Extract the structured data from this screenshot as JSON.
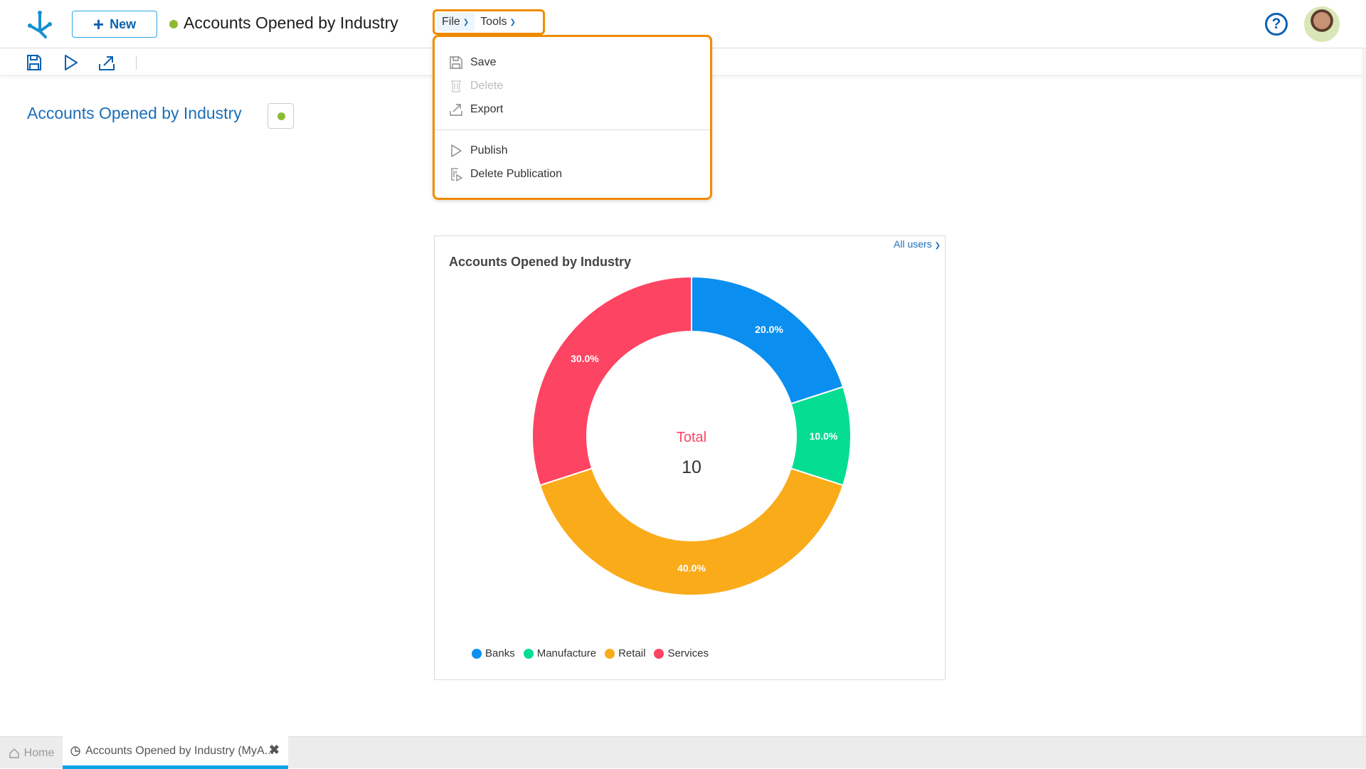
{
  "header": {
    "new_label": "New",
    "title": "Accounts Opened by Industry",
    "menus": [
      {
        "label": "File",
        "active": true
      },
      {
        "label": "Tools"
      }
    ],
    "help_icon": "question-circle-icon"
  },
  "toolbar": {
    "icons": [
      "save-icon",
      "play-icon",
      "export-icon"
    ]
  },
  "page": {
    "title": "Accounts Opened by Industry",
    "status_color": "#8dba33"
  },
  "file_menu": {
    "items": [
      {
        "label": "Save",
        "icon": "save-icon",
        "disabled": false
      },
      {
        "label": "Delete",
        "icon": "trash-icon",
        "disabled": true
      },
      {
        "label": "Export",
        "icon": "export-icon",
        "disabled": false
      },
      {
        "label": "Publish",
        "icon": "play-icon",
        "disabled": false
      },
      {
        "label": "Delete Publication",
        "icon": "delete-publication-icon",
        "disabled": false
      }
    ]
  },
  "card": {
    "filter_label": "All users"
  },
  "chart_data": {
    "type": "pie",
    "variant": "donut",
    "title": "Accounts Opened by Industry",
    "center_label": "Total",
    "center_value": "10",
    "categories": [
      "Banks",
      "Manufacture",
      "Retail",
      "Services"
    ],
    "values": [
      2,
      1,
      4,
      3
    ],
    "data_labels": [
      "20.0%",
      "10.0%",
      "40.0%",
      "30.0%"
    ],
    "colors": [
      "#0a8ff0",
      "#05dd92",
      "#f9ab1a",
      "#fd4462"
    ],
    "legend": "bottom"
  },
  "tabs": [
    {
      "label": "Home",
      "icon": "home-icon"
    },
    {
      "label": "Accounts Opened by Industry (MyA...",
      "icon": "pie-chart-icon",
      "active": true
    }
  ]
}
